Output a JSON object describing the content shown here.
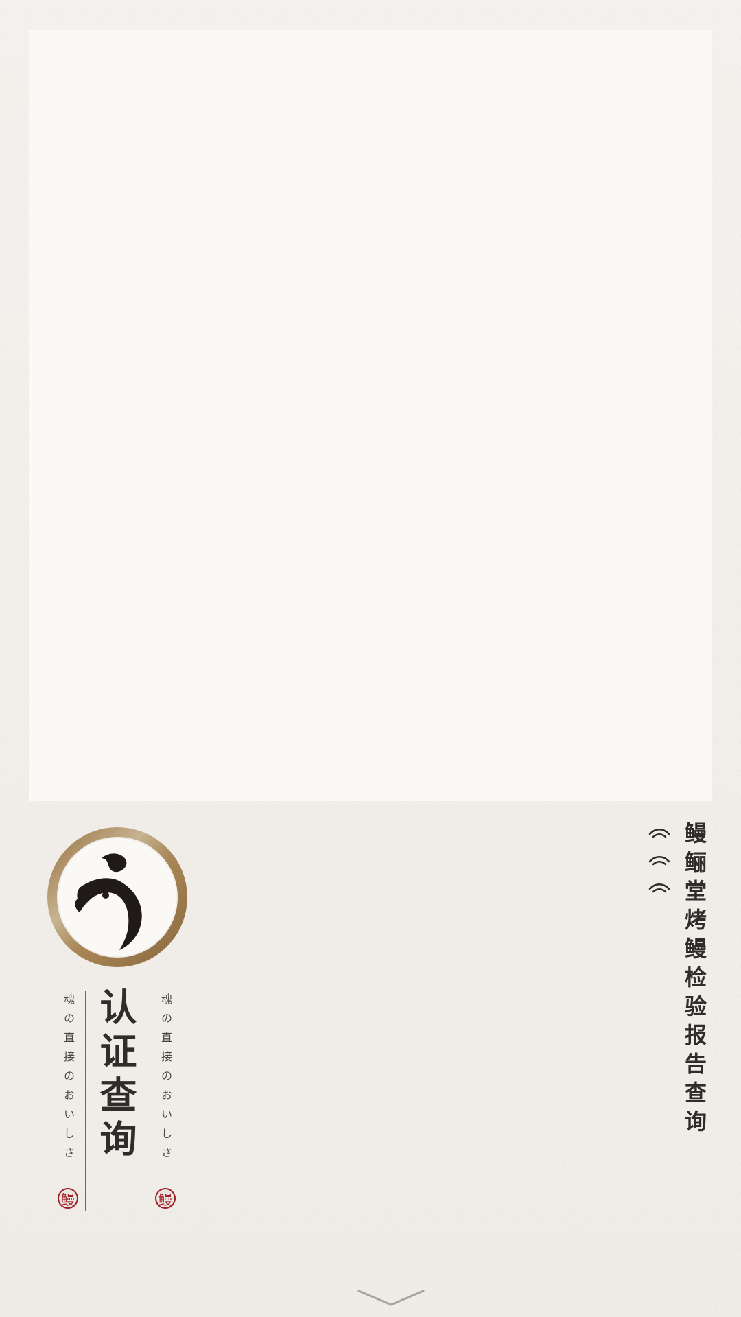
{
  "brand": {
    "logo": "eel-brand-logo",
    "main_title": "认证查询",
    "slogan_left": "魂の直接のおいしさ",
    "slogan_right": "魂の直接のおいしさ",
    "seal_left_char": "鳗",
    "seal_right_char": "鳗"
  },
  "right_panel": {
    "title": "鳗鲡堂烤鳗检验报告查询"
  },
  "icons": {
    "wave": "wave-icon",
    "down_chevron": "down-chevron-icon"
  },
  "colors": {
    "background": "#f1eee9",
    "panel": "#faf9f6",
    "text": "#2f2c2a",
    "accent_gold": "#a88656",
    "seal_red": "#9c1f24"
  }
}
